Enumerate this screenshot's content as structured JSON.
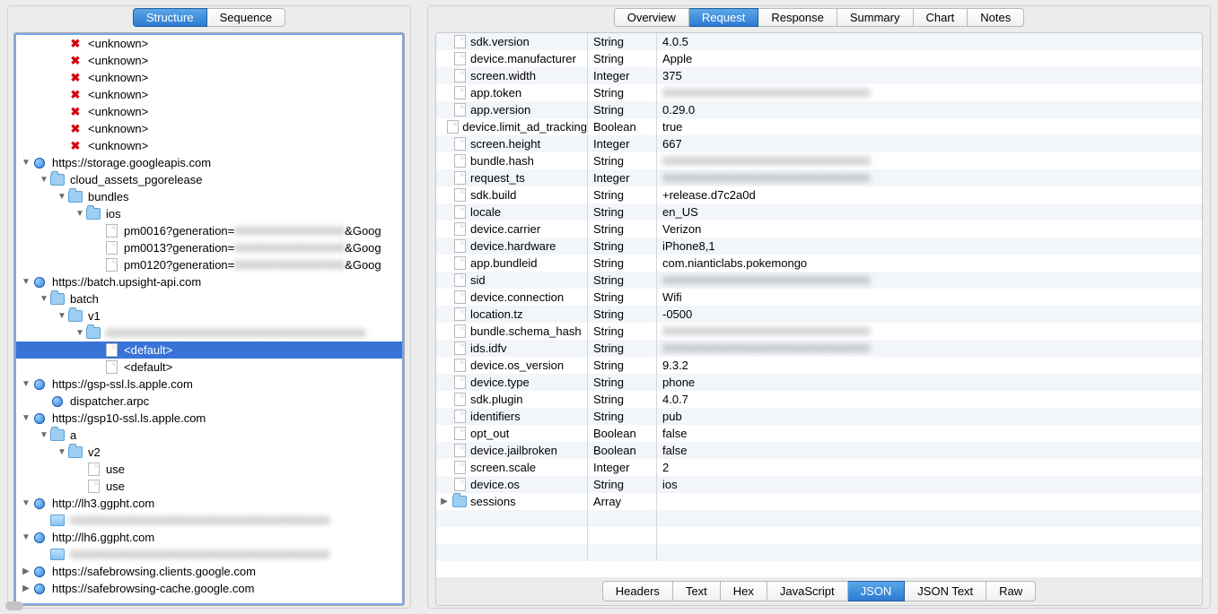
{
  "left_tabs": [
    "Structure",
    "Sequence"
  ],
  "left_active_tab": 0,
  "right_tabs": [
    "Overview",
    "Request",
    "Response",
    "Summary",
    "Chart",
    "Notes"
  ],
  "right_active_tab": 1,
  "bottom_tabs": [
    "Headers",
    "Text",
    "Hex",
    "JavaScript",
    "JSON",
    "JSON Text",
    "Raw"
  ],
  "bottom_active_tab": 4,
  "tree": [
    {
      "indent": 2,
      "disc": "",
      "icon": "x",
      "label": "<unknown>"
    },
    {
      "indent": 2,
      "disc": "",
      "icon": "x",
      "label": "<unknown>"
    },
    {
      "indent": 2,
      "disc": "",
      "icon": "x",
      "label": "<unknown>"
    },
    {
      "indent": 2,
      "disc": "",
      "icon": "x",
      "label": "<unknown>"
    },
    {
      "indent": 2,
      "disc": "",
      "icon": "x",
      "label": "<unknown>"
    },
    {
      "indent": 2,
      "disc": "",
      "icon": "x",
      "label": "<unknown>"
    },
    {
      "indent": 2,
      "disc": "",
      "icon": "x",
      "label": "<unknown>"
    },
    {
      "indent": 0,
      "disc": "▼",
      "icon": "globe",
      "label": "https://storage.googleapis.com"
    },
    {
      "indent": 1,
      "disc": "▼",
      "icon": "folder",
      "label": "cloud_assets_pgorelease"
    },
    {
      "indent": 2,
      "disc": "▼",
      "icon": "folder",
      "label": "bundles"
    },
    {
      "indent": 3,
      "disc": "▼",
      "icon": "folder",
      "label": "ios"
    },
    {
      "indent": 4,
      "disc": "",
      "icon": "file",
      "label": "pm0016?generation=",
      "blurmid": true,
      "tail": "&Goog"
    },
    {
      "indent": 4,
      "disc": "",
      "icon": "file",
      "label": "pm0013?generation=",
      "blurmid": true,
      "tail": "&Goog"
    },
    {
      "indent": 4,
      "disc": "",
      "icon": "file",
      "label": "pm0120?generation=",
      "blurmid": true,
      "tail": "&Goog"
    },
    {
      "indent": 0,
      "disc": "▼",
      "icon": "globe",
      "label": "https://batch.upsight-api.com"
    },
    {
      "indent": 1,
      "disc": "▼",
      "icon": "folder",
      "label": "batch"
    },
    {
      "indent": 2,
      "disc": "▼",
      "icon": "folder",
      "label": "v1"
    },
    {
      "indent": 3,
      "disc": "▼",
      "icon": "folder",
      "label": "",
      "blurmid": true,
      "wide_blur": true
    },
    {
      "indent": 4,
      "disc": "",
      "icon": "file",
      "label": "<default>",
      "selected": true
    },
    {
      "indent": 4,
      "disc": "",
      "icon": "file",
      "label": "<default>"
    },
    {
      "indent": 0,
      "disc": "▼",
      "icon": "globe",
      "label": "https://gsp-ssl.ls.apple.com"
    },
    {
      "indent": 1,
      "disc": "",
      "icon": "globe",
      "label": "dispatcher.arpc"
    },
    {
      "indent": 0,
      "disc": "▼",
      "icon": "globe",
      "label": "https://gsp10-ssl.ls.apple.com"
    },
    {
      "indent": 1,
      "disc": "▼",
      "icon": "folder",
      "label": "a"
    },
    {
      "indent": 2,
      "disc": "▼",
      "icon": "folder",
      "label": "v2"
    },
    {
      "indent": 3,
      "disc": "",
      "icon": "file",
      "label": "use"
    },
    {
      "indent": 3,
      "disc": "",
      "icon": "file",
      "label": "use"
    },
    {
      "indent": 0,
      "disc": "▼",
      "icon": "globe",
      "label": "http://lh3.ggpht.com"
    },
    {
      "indent": 1,
      "disc": "",
      "icon": "img",
      "label": "",
      "blurmid": true,
      "wide_blur": true
    },
    {
      "indent": 0,
      "disc": "▼",
      "icon": "globe",
      "label": "http://lh6.ggpht.com"
    },
    {
      "indent": 1,
      "disc": "",
      "icon": "img",
      "label": "",
      "blurmid": true,
      "wide_blur": true
    },
    {
      "indent": 0,
      "disc": "▶",
      "icon": "globe",
      "label": "https://safebrowsing.clients.google.com"
    },
    {
      "indent": 0,
      "disc": "▶",
      "icon": "globe",
      "label": "https://safebrowsing-cache.google.com"
    }
  ],
  "kv": [
    {
      "key": "sdk.version",
      "type": "String",
      "val": "4.0.5",
      "icon": "file"
    },
    {
      "key": "device.manufacturer",
      "type": "String",
      "val": "Apple",
      "icon": "file"
    },
    {
      "key": "screen.width",
      "type": "Integer",
      "val": "375",
      "icon": "file"
    },
    {
      "key": "app.token",
      "type": "String",
      "val": "",
      "blur": true,
      "icon": "file"
    },
    {
      "key": "app.version",
      "type": "String",
      "val": "0.29.0",
      "icon": "file"
    },
    {
      "key": "device.limit_ad_tracking",
      "type": "Boolean",
      "val": "true",
      "icon": "file"
    },
    {
      "key": "screen.height",
      "type": "Integer",
      "val": "667",
      "icon": "file"
    },
    {
      "key": "bundle.hash",
      "type": "String",
      "val": "",
      "blur": true,
      "icon": "file"
    },
    {
      "key": "request_ts",
      "type": "Integer",
      "val": "",
      "blur": true,
      "icon": "file"
    },
    {
      "key": "sdk.build",
      "type": "String",
      "val": "+release.d7c2a0d",
      "icon": "file"
    },
    {
      "key": "locale",
      "type": "String",
      "val": "en_US",
      "icon": "file"
    },
    {
      "key": "device.carrier",
      "type": "String",
      "val": "Verizon",
      "icon": "file"
    },
    {
      "key": "device.hardware",
      "type": "String",
      "val": "iPhone8,1",
      "icon": "file"
    },
    {
      "key": "app.bundleid",
      "type": "String",
      "val": "com.nianticlabs.pokemongo",
      "icon": "file"
    },
    {
      "key": "sid",
      "type": "String",
      "val": "",
      "blur": true,
      "icon": "file"
    },
    {
      "key": "device.connection",
      "type": "String",
      "val": "Wifi",
      "icon": "file"
    },
    {
      "key": "location.tz",
      "type": "String",
      "val": "-0500",
      "icon": "file"
    },
    {
      "key": "bundle.schema_hash",
      "type": "String",
      "val": "",
      "blur": true,
      "icon": "file"
    },
    {
      "key": "ids.idfv",
      "type": "String",
      "val": "",
      "blur": true,
      "icon": "file"
    },
    {
      "key": "device.os_version",
      "type": "String",
      "val": "9.3.2",
      "icon": "file"
    },
    {
      "key": "device.type",
      "type": "String",
      "val": "phone",
      "icon": "file"
    },
    {
      "key": "sdk.plugin",
      "type": "String",
      "val": "4.0.7",
      "icon": "file"
    },
    {
      "key": "identifiers",
      "type": "String",
      "val": "pub",
      "icon": "file"
    },
    {
      "key": "opt_out",
      "type": "Boolean",
      "val": "false",
      "icon": "file"
    },
    {
      "key": "device.jailbroken",
      "type": "Boolean",
      "val": "false",
      "icon": "file"
    },
    {
      "key": "screen.scale",
      "type": "Integer",
      "val": "2",
      "icon": "file"
    },
    {
      "key": "device.os",
      "type": "String",
      "val": "ios",
      "icon": "file"
    },
    {
      "key": "sessions",
      "type": "Array",
      "val": "",
      "icon": "folder",
      "disc": "▶"
    }
  ]
}
